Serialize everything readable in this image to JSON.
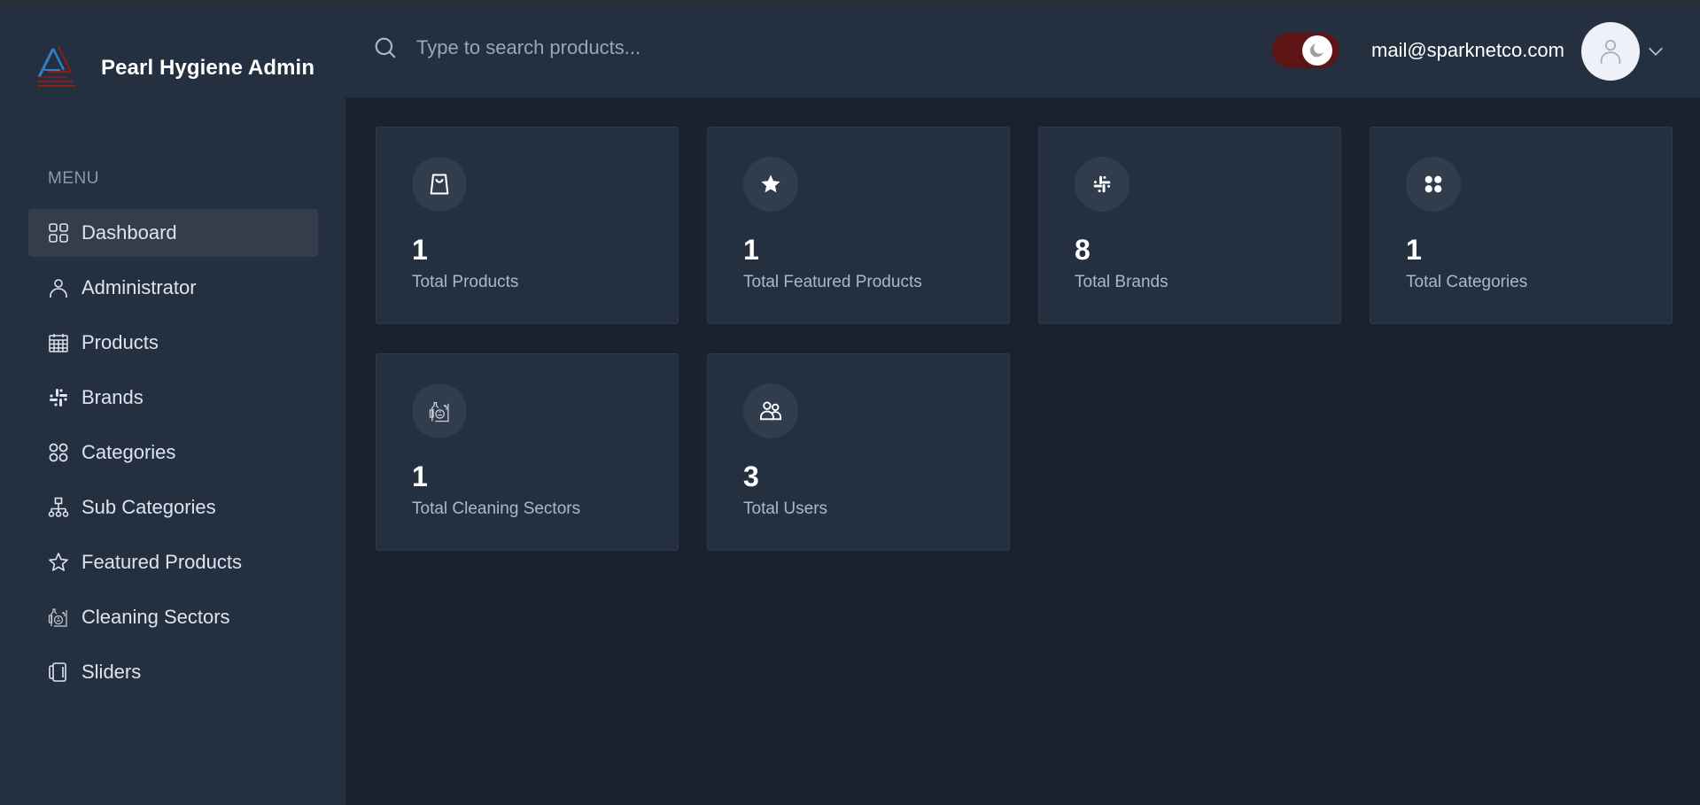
{
  "app": {
    "title": "Pearl Hygiene Admin",
    "logo_icon": "pearl-hygiene-logo"
  },
  "sidebar": {
    "menu_label": "MENU",
    "items": [
      {
        "label": "Dashboard",
        "icon": "dashboard-grid-icon",
        "active": true
      },
      {
        "label": "Administrator",
        "icon": "user-icon",
        "active": false
      },
      {
        "label": "Products",
        "icon": "calendar-grid-icon",
        "active": false
      },
      {
        "label": "Brands",
        "icon": "slack-hash-icon",
        "active": false
      },
      {
        "label": "Categories",
        "icon": "four-circles-icon",
        "active": false
      },
      {
        "label": "Sub Categories",
        "icon": "sitemap-icon",
        "active": false
      },
      {
        "label": "Featured Products",
        "icon": "star-icon",
        "active": false
      },
      {
        "label": "Cleaning Sectors",
        "icon": "cleaning-supplies-icon",
        "active": false
      },
      {
        "label": "Sliders",
        "icon": "slider-icon",
        "active": false
      }
    ]
  },
  "header": {
    "search": {
      "placeholder": "Type to search products...",
      "value": "",
      "icon": "search-icon"
    },
    "theme_toggle": {
      "state": "dark",
      "icon": "moon-icon",
      "color": "#5c1414"
    },
    "user_email": "mail@sparknetco.com",
    "avatar_icon": "user-icon",
    "dropdown_icon": "chevron-down-icon"
  },
  "stats": [
    {
      "value": "1",
      "label": "Total Products",
      "icon": "shopping-bag-icon"
    },
    {
      "value": "1",
      "label": "Total Featured Products",
      "icon": "star-icon"
    },
    {
      "value": "8",
      "label": "Total Brands",
      "icon": "slack-hash-icon"
    },
    {
      "value": "1",
      "label": "Total Categories",
      "icon": "four-circles-icon"
    },
    {
      "value": "1",
      "label": "Total Cleaning Sectors",
      "icon": "cleaning-supplies-icon"
    },
    {
      "value": "3",
      "label": "Total Users",
      "icon": "users-icon"
    }
  ],
  "colors": {
    "sidebar_bg": "#24303f",
    "main_bg": "#1c222d",
    "card_bg": "#24303f",
    "active_item_bg": "#333d4c",
    "toggle_bg": "#5c1414"
  }
}
